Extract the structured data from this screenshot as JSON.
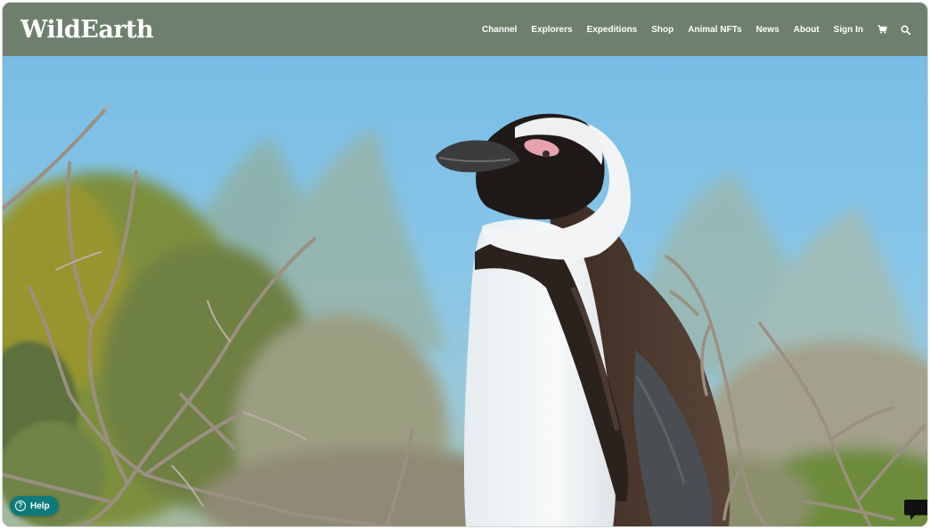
{
  "brand": {
    "logo_text": "WildEarth"
  },
  "nav": {
    "items": [
      {
        "label": "Channel"
      },
      {
        "label": "Explorers"
      },
      {
        "label": "Expeditions"
      },
      {
        "label": "Shop"
      },
      {
        "label": "Animal NFTs"
      },
      {
        "label": "News"
      },
      {
        "label": "About"
      },
      {
        "label": "Sign In"
      }
    ],
    "icons": [
      "cart-icon",
      "search-icon"
    ]
  },
  "hero": {
    "subject": "penguin-photo"
  },
  "help": {
    "label": "Help"
  },
  "chat": {
    "icon": "chat-bubble-icon"
  },
  "colors": {
    "navbar": "#6e806d",
    "help_button": "#0f7a7a",
    "sky": "#7bbfe4"
  }
}
